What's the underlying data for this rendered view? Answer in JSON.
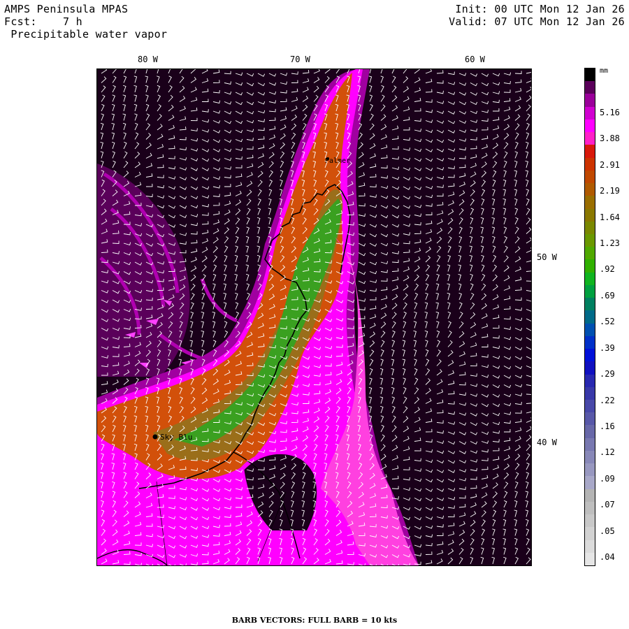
{
  "header": {
    "model": "AMPS Peninsula MPAS",
    "fcst_label": "Fcst:",
    "fcst_value": "7 h",
    "field": "Precipitable water vapor",
    "init": "Init: 00 UTC Mon 12 Jan 26",
    "valid": "Valid: 07 UTC Mon 12 Jan 26"
  },
  "longitude_labels": [
    "80 W",
    "70 W",
    "60 W"
  ],
  "latitude_labels": [
    "50 W",
    "40 W"
  ],
  "places": [
    "Palmer",
    "Sky Blu"
  ],
  "colorbar": {
    "unit": "mm",
    "labels": [
      "5.16",
      "3.88",
      "2.91",
      "2.19",
      "1.64",
      "1.23",
      ".92",
      ".69",
      ".52",
      ".39",
      ".29",
      ".22",
      ".16",
      ".12",
      ".09",
      ".07",
      ".05",
      ".04"
    ],
    "colors": [
      "#000000",
      "#5a005a",
      "#9a009a",
      "#d000d0",
      "#ff00ff",
      "#ff20c8",
      "#d8180a",
      "#cc3300",
      "#c04800",
      "#b05a00",
      "#9a6e00",
      "#8a7800",
      "#7a8800",
      "#6a9800",
      "#50a800",
      "#30b000",
      "#10b420",
      "#00a040",
      "#008060",
      "#006a88",
      "#0050b0",
      "#0030c8",
      "#0010d8",
      "#1010c0",
      "#2828b0",
      "#3838a8",
      "#4848a8",
      "#5858a8",
      "#6868a8",
      "#7878b0",
      "#8888b8",
      "#9898c0",
      "#a8a8c8",
      "#b4b4b4",
      "#bebebe",
      "#c8c8c8",
      "#d2d2d2",
      "#dcdcdc",
      "#e6e6e6"
    ]
  },
  "footer": "BARB VECTORS:  FULL BARB = 10 kts"
}
